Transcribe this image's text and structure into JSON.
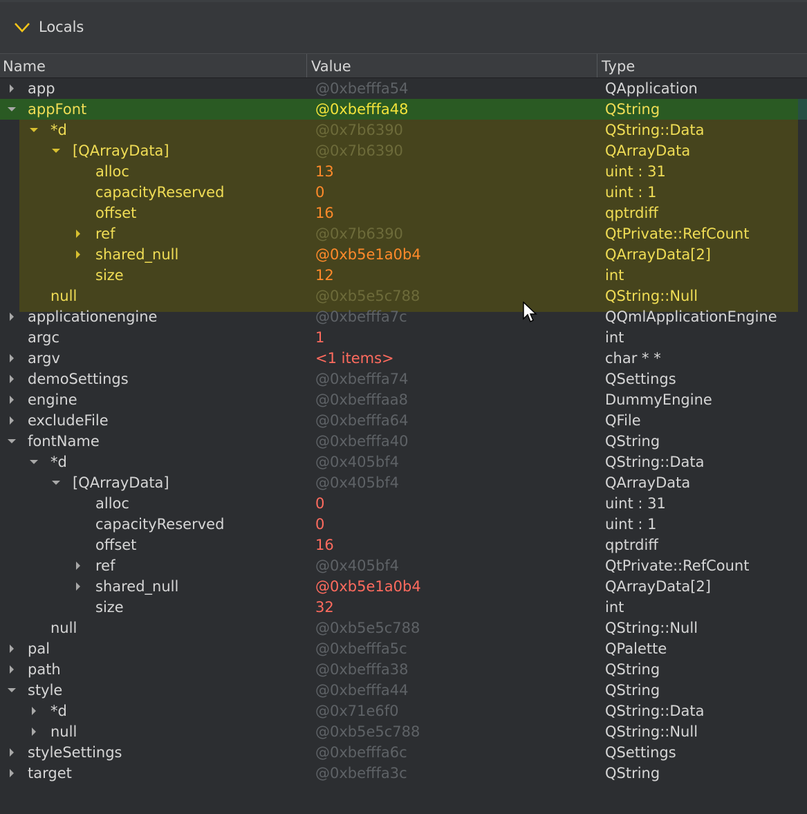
{
  "panel": {
    "title": "Locals",
    "chevron_icon": "chevron-down-icon"
  },
  "columns": {
    "name": "Name",
    "value": "Value",
    "type": "Type"
  },
  "colors": {
    "background": "#2c2e31",
    "selection_green": "#2a5a23",
    "highlight_yellow": "#46441d",
    "changed_value": "#ff6b5e",
    "arrow_yellow": "#f5d232"
  },
  "rows": [
    {
      "name": "app",
      "value": "@0xbefffa54",
      "type": "QApplication"
    },
    {
      "name": "appFont",
      "value": "@0xbefffa48",
      "type": "QString"
    },
    {
      "name": "*d",
      "value": "@0x7b6390",
      "type": "QString::Data"
    },
    {
      "name": "[QArrayData]",
      "value": "@0x7b6390",
      "type": "QArrayData"
    },
    {
      "name": "alloc",
      "value": "13",
      "type": "uint : 31"
    },
    {
      "name": "capacityReserved",
      "value": "0",
      "type": "uint : 1"
    },
    {
      "name": "offset",
      "value": "16",
      "type": "qptrdiff"
    },
    {
      "name": "ref",
      "value": "@0x7b6390",
      "type": "QtPrivate::RefCount"
    },
    {
      "name": "shared_null",
      "value": "@0xb5e1a0b4",
      "type": "QArrayData[2]"
    },
    {
      "name": "size",
      "value": "12",
      "type": "int"
    },
    {
      "name": "null",
      "value": "@0xb5e5c788",
      "type": "QString::Null"
    },
    {
      "name": "applicationengine",
      "value": "@0xbefffa7c",
      "type": "QQmlApplicationEngine"
    },
    {
      "name": "argc",
      "value": "1",
      "type": "int"
    },
    {
      "name": "argv",
      "value": "<1 items>",
      "type": "char * *"
    },
    {
      "name": "demoSettings",
      "value": "@0xbefffa74",
      "type": "QSettings"
    },
    {
      "name": "engine",
      "value": "@0xbefffaa8",
      "type": "DummyEngine"
    },
    {
      "name": "excludeFile",
      "value": "@0xbefffa64",
      "type": "QFile"
    },
    {
      "name": "fontName",
      "value": "@0xbefffa40",
      "type": "QString"
    },
    {
      "name": "*d",
      "value": "@0x405bf4",
      "type": "QString::Data"
    },
    {
      "name": "[QArrayData]",
      "value": "@0x405bf4",
      "type": "QArrayData"
    },
    {
      "name": "alloc",
      "value": "0",
      "type": "uint : 31"
    },
    {
      "name": "capacityReserved",
      "value": "0",
      "type": "uint : 1"
    },
    {
      "name": "offset",
      "value": "16",
      "type": "qptrdiff"
    },
    {
      "name": "ref",
      "value": "@0x405bf4",
      "type": "QtPrivate::RefCount"
    },
    {
      "name": "shared_null",
      "value": "@0xb5e1a0b4",
      "type": "QArrayData[2]"
    },
    {
      "name": "size",
      "value": "32",
      "type": "int"
    },
    {
      "name": "null",
      "value": "@0xb5e5c788",
      "type": "QString::Null"
    },
    {
      "name": "pal",
      "value": "@0xbefffa5c",
      "type": "QPalette"
    },
    {
      "name": "path",
      "value": "@0xbefffa38",
      "type": "QString"
    },
    {
      "name": "style",
      "value": "@0xbefffa44",
      "type": "QString"
    },
    {
      "name": "*d",
      "value": "@0x71e6f0",
      "type": "QString::Data"
    },
    {
      "name": "null",
      "value": "@0xb5e5c788",
      "type": "QString::Null"
    },
    {
      "name": "styleSettings",
      "value": "@0xbefffa6c",
      "type": "QSettings"
    },
    {
      "name": "target",
      "value": "@0xbefffa3c",
      "type": "QString"
    }
  ]
}
